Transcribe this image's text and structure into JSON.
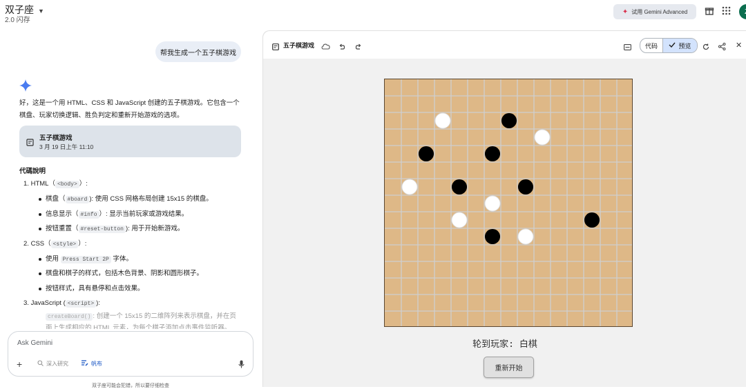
{
  "app": {
    "title": "双子座",
    "version": "2.0 闪存",
    "advanced_label": "试用 Gemini Advanced",
    "avatar_letter": "Z"
  },
  "chat": {
    "user_message": "帮我生成一个五子棋游戏",
    "intro": "好，这是一个用 HTML、CSS 和 JavaScript 创建的五子棋游戏。它包含一个棋盘、玩家切换逻辑、胜负判定和重新开始游戏的选项。",
    "doc_card": {
      "title": "五子棋游戏",
      "date": "3 月 19 日上午 11:10"
    },
    "section_heading": "代碼說明",
    "items": [
      {
        "num": "1.",
        "label": "HTML（",
        "code": "<body>",
        "tail": "）:",
        "bullets": [
          {
            "pre": "棋盘（",
            "code": "#board",
            "post": "): 使用 CSS 网格布局创建 15x15 的棋盘。"
          },
          {
            "pre": "信息显示（",
            "code": "#info",
            "post": "）: 显示当前玩家或游戏结果。"
          },
          {
            "pre": "按钮重置（",
            "code": "#reset-button",
            "post": "): 用于开始新游戏。"
          }
        ]
      },
      {
        "num": "2.",
        "label": "CSS（",
        "code": "<style>",
        "tail": "）:",
        "bullets": [
          {
            "pre": "使用 ",
            "code": "Press Start 2P",
            "post": " 字体。"
          },
          {
            "pre": "棋盘和棋子的样式，包括木色背景、阴影和圆形棋子。",
            "code": "",
            "post": ""
          },
          {
            "pre": "按钮样式，具有悬停和点击效果。",
            "code": "",
            "post": ""
          }
        ]
      },
      {
        "num": "3.",
        "label": "JavaScript (",
        "code": "<script>",
        "tail": "):",
        "bullets": []
      }
    ],
    "faded": {
      "code": "createBoard()",
      "text": ": 创建一个 15x15 的二维阵列来表示棋盘，并在页面上生成相应的 HTML 元素，为每个棋子添加点击事件监听器。"
    },
    "input_placeholder": "Ask Gemini",
    "deep_research": "深入研究",
    "canvas": "帆布",
    "disclaimer": "双子座可能会犯错，所以要仔细检查"
  },
  "panel": {
    "title": "五子棋游戏",
    "tab_code": "代码",
    "tab_preview": "预览",
    "status": "轮到玩家: 白棋",
    "reset_label": "重新开始"
  },
  "game": {
    "size": 15,
    "colors": {
      "board": "#deb887",
      "grid": "#cfcfcf",
      "black": "#000000",
      "white": "#ffffff"
    },
    "stones": [
      {
        "row": 2,
        "col": 3,
        "color": "white"
      },
      {
        "row": 2,
        "col": 7,
        "color": "black"
      },
      {
        "row": 3,
        "col": 9,
        "color": "white"
      },
      {
        "row": 4,
        "col": 2,
        "color": "black"
      },
      {
        "row": 4,
        "col": 6,
        "color": "black"
      },
      {
        "row": 6,
        "col": 1,
        "color": "white"
      },
      {
        "row": 6,
        "col": 4,
        "color": "black"
      },
      {
        "row": 6,
        "col": 8,
        "color": "black"
      },
      {
        "row": 7,
        "col": 6,
        "color": "white"
      },
      {
        "row": 8,
        "col": 4,
        "color": "white"
      },
      {
        "row": 8,
        "col": 12,
        "color": "black"
      },
      {
        "row": 9,
        "col": 6,
        "color": "black"
      },
      {
        "row": 9,
        "col": 8,
        "color": "white"
      }
    ]
  }
}
